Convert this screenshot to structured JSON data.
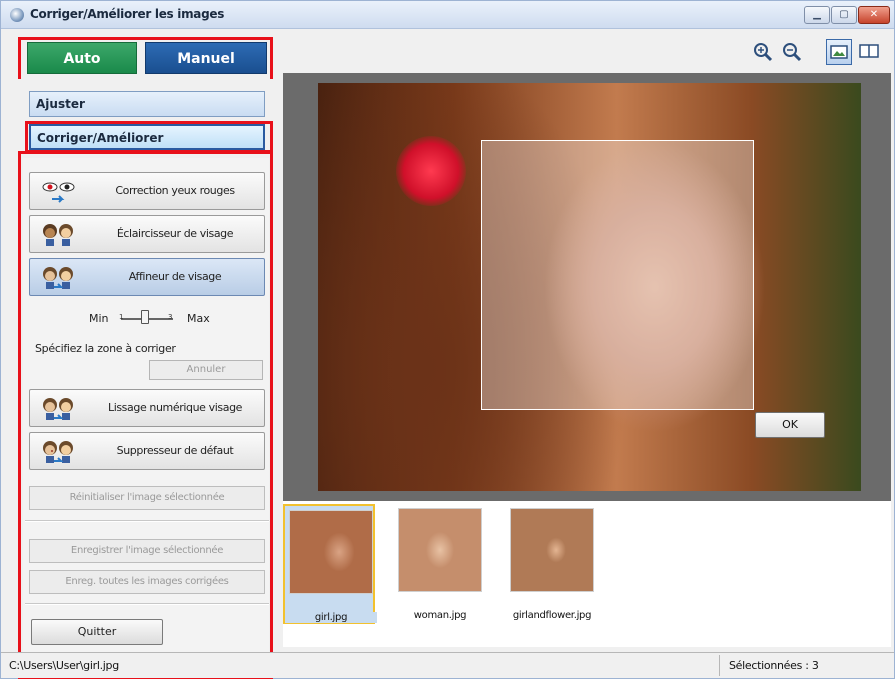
{
  "window": {
    "title": "Corriger/Améliorer les images",
    "controls": [
      "minimize-icon",
      "maximize-icon",
      "close-icon"
    ]
  },
  "mode_tabs": [
    {
      "label": "Auto",
      "active": false
    },
    {
      "label": "Manuel",
      "active": true
    }
  ],
  "sections": {
    "adjust_label": "Ajuster",
    "correct_label": "Corriger/Améliorer"
  },
  "tools": [
    {
      "label": "Correction yeux rouges",
      "icon": "red-eye-icon"
    },
    {
      "label": "Éclaircisseur de visage",
      "icon": "face-brightener-icon"
    },
    {
      "label": "Affineur de visage",
      "icon": "face-sharpener-icon",
      "selected": true
    },
    {
      "label": "Lissage numérique visage",
      "icon": "face-smoothing-icon"
    },
    {
      "label": "Suppresseur de défaut",
      "icon": "blemish-remover-icon"
    }
  ],
  "slider": {
    "min_label": "Min",
    "max_label": "Max",
    "ticks": [
      "1",
      "2",
      "3"
    ],
    "value": 2
  },
  "zone": {
    "instruction": "Spécifiez la zone à corriger",
    "cancel_label": "Annuler"
  },
  "actions": {
    "reset_label": "Réinitialiser l'image sélectionnée",
    "save_selected_label": "Enregistrer l'image sélectionnée",
    "save_all_label": "Enreg. toutes les images corrigées",
    "quit_label": "Quitter"
  },
  "toolbar": {
    "icons": [
      "zoom-in-icon",
      "zoom-out-icon",
      "view-single-icon",
      "view-compare-icon"
    ]
  },
  "preview": {
    "ok_label": "OK"
  },
  "thumbnails": [
    {
      "name": "girl.jpg",
      "selected": true
    },
    {
      "name": "woman.jpg",
      "selected": false
    },
    {
      "name": "girlandflower.jpg",
      "selected": false
    }
  ],
  "status": {
    "path": "C:\\Users\\User\\girl.jpg",
    "selected_count": "Sélectionnées : 3"
  },
  "colors": {
    "highlight_frame": "#e8101a",
    "auto_tab": "#1a8a4a",
    "manual_tab": "#1a4f90",
    "thumb_selected": "#f2c12e"
  }
}
